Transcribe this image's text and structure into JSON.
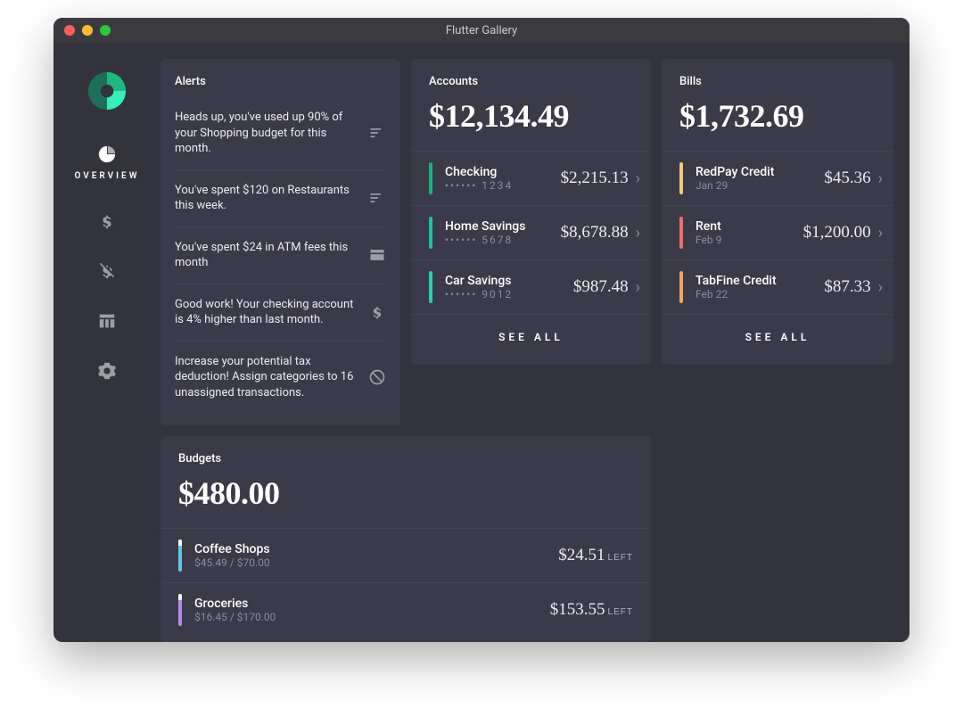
{
  "window_title": "Flutter Gallery",
  "nav": {
    "overview_label": "OVERVIEW"
  },
  "accounts": {
    "title": "Accounts",
    "total": "$12,134.49",
    "see_all": "SEE ALL",
    "items": [
      {
        "name": "Checking",
        "sub": "•••••• 1234",
        "value": "$2,215.13",
        "color": "#17B284"
      },
      {
        "name": "Home Savings",
        "sub": "•••••• 5678",
        "value": "$8,678.88",
        "color": "#1FC39A"
      },
      {
        "name": "Car Savings",
        "sub": "•••••• 9012",
        "value": "$987.48",
        "color": "#2AD0A8"
      }
    ]
  },
  "bills": {
    "title": "Bills",
    "total": "$1,732.69",
    "see_all": "SEE ALL",
    "items": [
      {
        "name": "RedPay Credit",
        "sub": "Jan 29",
        "value": "$45.36",
        "color": "#F7C873"
      },
      {
        "name": "Rent",
        "sub": "Feb 9",
        "value": "$1,200.00",
        "color": "#F36D6F"
      },
      {
        "name": "TabFine Credit",
        "sub": "Feb 22",
        "value": "$87.33",
        "color": "#F6A25B"
      }
    ]
  },
  "alerts": {
    "title": "Alerts",
    "items": [
      {
        "text": "Heads up, you've used up 90% of your Shopping budget for this month.",
        "icon": "sort"
      },
      {
        "text": "You've spent $120 on Restaurants this week.",
        "icon": "sort"
      },
      {
        "text": "You've spent $24 in ATM fees this month",
        "icon": "card"
      },
      {
        "text": "Good work! Your checking account is 4% higher than last month.",
        "icon": "dollar"
      },
      {
        "text": "Increase your potential tax deduction! Assign categories to 16 unassigned transactions.",
        "icon": "block"
      }
    ]
  },
  "budgets": {
    "title": "Budgets",
    "total": "$480.00",
    "left_label": "LEFT",
    "items": [
      {
        "name": "Coffee Shops",
        "sub": "$45.49 / $70.00",
        "value": "$24.51",
        "color": "#5FC7E6"
      },
      {
        "name": "Groceries",
        "sub": "$16.45 / $170.00",
        "value": "$153.55",
        "color": "#B48BE6"
      }
    ]
  }
}
